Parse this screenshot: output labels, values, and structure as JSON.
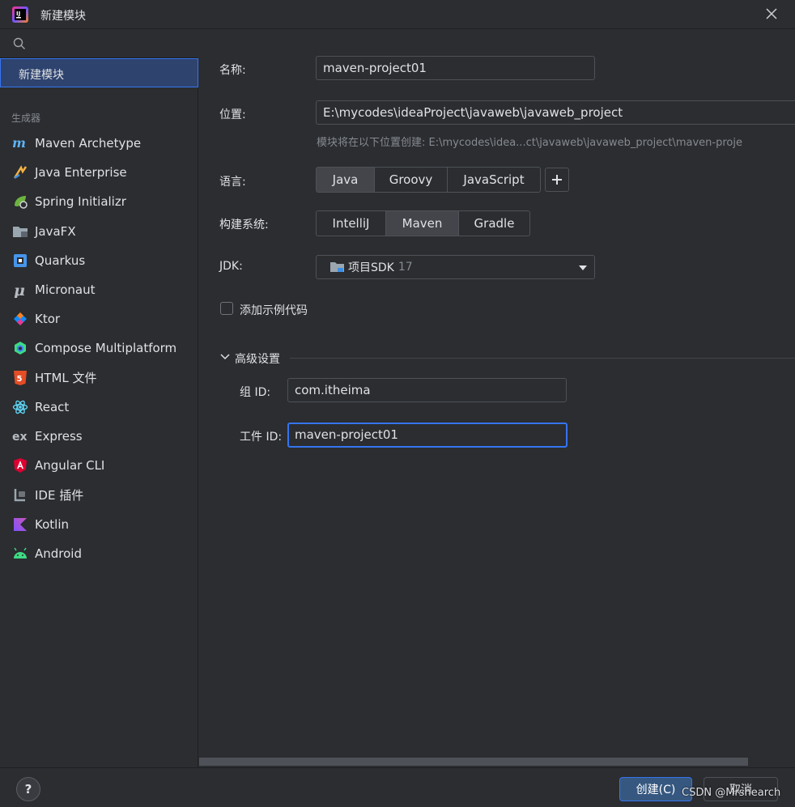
{
  "window": {
    "title": "新建模块"
  },
  "sidebar": {
    "selected_item": "新建模块",
    "section_label": "生成器",
    "generators": [
      {
        "label": "Maven Archetype",
        "icon": "maven-icon"
      },
      {
        "label": "Java Enterprise",
        "icon": "java-enterprise-icon"
      },
      {
        "label": "Spring Initializr",
        "icon": "spring-icon"
      },
      {
        "label": "JavaFX",
        "icon": "javafx-folder-icon"
      },
      {
        "label": "Quarkus",
        "icon": "quarkus-icon"
      },
      {
        "label": "Micronaut",
        "icon": "micronaut-icon"
      },
      {
        "label": "Ktor",
        "icon": "ktor-icon"
      },
      {
        "label": "Compose Multiplatform",
        "icon": "compose-icon"
      },
      {
        "label": "HTML 文件",
        "icon": "html5-icon"
      },
      {
        "label": "React",
        "icon": "react-icon"
      },
      {
        "label": "Express",
        "icon": "express-icon"
      },
      {
        "label": "Angular CLI",
        "icon": "angular-icon"
      },
      {
        "label": "IDE 插件",
        "icon": "ide-plugin-icon"
      },
      {
        "label": "Kotlin",
        "icon": "kotlin-icon"
      },
      {
        "label": "Android",
        "icon": "android-icon"
      }
    ]
  },
  "form": {
    "name_label": "名称:",
    "name_value": "maven-project01",
    "location_label": "位置:",
    "location_value": "E:\\mycodes\\ideaProject\\javaweb\\javaweb_project",
    "location_hint": "模块将在以下位置创建: E:\\mycodes\\idea...ct\\javaweb\\javaweb_project\\maven-proje",
    "language_label": "语言:",
    "languages": [
      "Java",
      "Groovy",
      "JavaScript"
    ],
    "language_selected": "Java",
    "build_label": "构建系统:",
    "build_systems": [
      "IntelliJ",
      "Maven",
      "Gradle"
    ],
    "build_selected": "Maven",
    "jdk_label": "JDK:",
    "jdk_value": "项目SDK",
    "jdk_version": "17",
    "sample_code_label": "添加示例代码",
    "advanced_label": "高级设置",
    "group_id_label": "组 ID:",
    "group_id_value": "com.itheima",
    "artifact_id_label": "工件 ID:",
    "artifact_id_value": "maven-project01"
  },
  "footer": {
    "help_label": "?",
    "create_label": "创建(C)",
    "cancel_label": "取消",
    "watermark": "CSDN @Mrshearch"
  },
  "colors": {
    "background": "#2b2d30",
    "selection": "#2e436e",
    "accent": "#3574f0",
    "primary_button": "#365880"
  }
}
